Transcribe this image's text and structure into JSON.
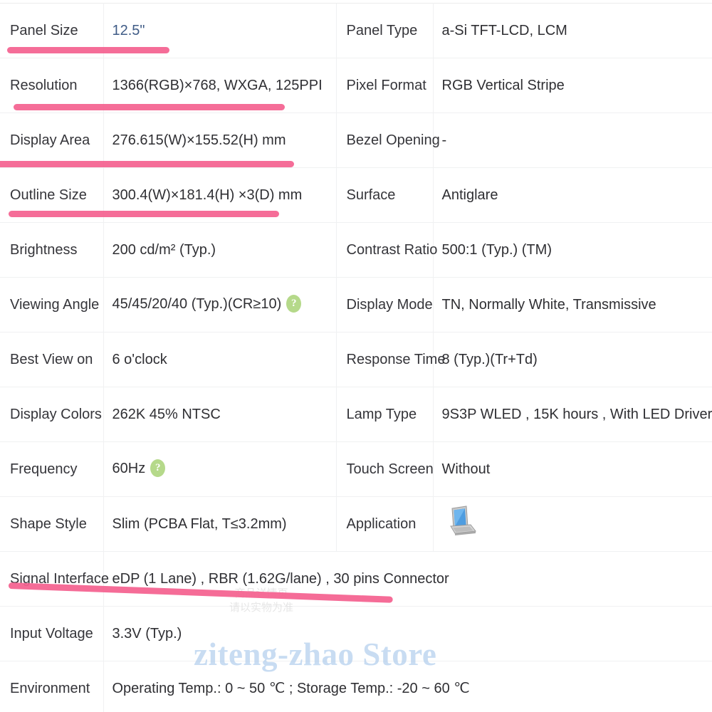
{
  "accent_colors": {
    "highlighter_pink": "#f4618f",
    "value_link_blue": "#3f5b86",
    "help_badge_green": "#b5d98a",
    "watermark_blue": "#9cc0e8",
    "grid_line": "#f0f1f2"
  },
  "table": {
    "rows": [
      {
        "label_left": "Panel Size",
        "value_left": "12.5\"",
        "value_left_style": "accent",
        "label_right": "Panel Type",
        "value_right": "a-Si TFT-LCD, LCM"
      },
      {
        "label_left": "Resolution",
        "value_left": "1366(RGB)×768, WXGA, 125PPI",
        "label_right": "Pixel Format",
        "value_right": "RGB Vertical Stripe"
      },
      {
        "label_left": "Display Area",
        "value_left": "276.615(W)×155.52(H) mm",
        "label_right": "Bezel Opening",
        "value_right": "-"
      },
      {
        "label_left": "Outline Size",
        "value_left": "300.4(W)×181.4(H) ×3(D) mm",
        "label_right": "Surface",
        "value_right": "Antiglare"
      },
      {
        "label_left": "Brightness",
        "value_left": "200 cd/m² (Typ.)",
        "label_right": "Contrast Ratio",
        "value_right": "500:1 (Typ.) (TM)"
      },
      {
        "label_left": "Viewing Angle",
        "value_left": "45/45/20/40 (Typ.)(CR≥10)",
        "value_left_badge": "?",
        "label_right": "Display Mode",
        "value_right": "TN, Normally White, Transmissive"
      },
      {
        "label_left": "Best View on",
        "value_left": "6 o'clock",
        "label_right": "Response Time",
        "value_right": "8 (Typ.)(Tr+Td)"
      },
      {
        "label_left": "Display Colors",
        "value_left": "262K   45% NTSC",
        "label_right": "Lamp Type",
        "value_right": "9S3P WLED , 15K hours , With LED Driver"
      },
      {
        "label_left": "Frequency",
        "value_left": "60Hz",
        "value_left_badge": "?",
        "label_right": "Touch Screen",
        "value_right": "Without"
      },
      {
        "label_left": "Shape Style",
        "value_left": "Slim (PCBA Flat, T≤3.2mm)",
        "label_right": "Application",
        "value_right": "",
        "value_right_icon": "laptop-icon"
      },
      {
        "label_left": "Signal Interface",
        "value_left": "eDP (1 Lane) , RBR (1.62G/lane) , 30 pins Connector",
        "label_right": "",
        "value_right": ""
      },
      {
        "label_left": "Input Voltage",
        "value_left": "3.3V (Typ.)",
        "label_right": "",
        "value_right": ""
      },
      {
        "label_left": "Environment",
        "value_left": "Operating Temp.: 0 ~ 50 ℃ ; Storage Temp.: -20 ~ 60 ℃",
        "label_right": "",
        "value_right": ""
      }
    ]
  },
  "watermarks": {
    "store": "ziteng-zhao Store",
    "small": "商品详情页\n请以实物为准"
  }
}
